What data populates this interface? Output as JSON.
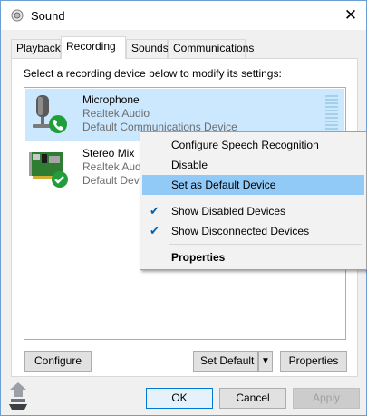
{
  "window": {
    "title": "Sound",
    "close_glyph": "✕"
  },
  "tabs": [
    {
      "label": "Playback"
    },
    {
      "label": "Recording",
      "active": true
    },
    {
      "label": "Sounds"
    },
    {
      "label": "Communications"
    }
  ],
  "panel": {
    "instruction": "Select a recording device below to modify its settings:"
  },
  "devices": [
    {
      "name": "Microphone",
      "driver": "Realtek Audio",
      "status": "Default Communications Device",
      "icon": "microphone-icon",
      "badge": "phone-badge-icon",
      "selected": true
    },
    {
      "name": "Stereo Mix",
      "driver": "Realtek Audio",
      "status": "Default Device",
      "icon": "sound-card-icon",
      "badge": "checkmark-badge-icon",
      "selected": false
    }
  ],
  "context_menu": {
    "items": [
      {
        "label": "Configure Speech Recognition"
      },
      {
        "label": "Disable"
      },
      {
        "label": "Set as Default Device",
        "highlighted": true
      },
      {
        "label": "Show Disabled Devices",
        "checked": true
      },
      {
        "label": "Show Disconnected Devices",
        "checked": true
      },
      {
        "label": "Properties",
        "bold": true
      }
    ],
    "check_glyph": "✔"
  },
  "buttons": {
    "configure": "Configure",
    "set_default": "Set Default",
    "set_default_arrow": "▼",
    "properties": "Properties",
    "ok": "OK",
    "cancel": "Cancel",
    "apply": "Apply"
  },
  "colors": {
    "selection": "#cce8ff",
    "menu_highlight": "#91c9f7",
    "ok_border": "#0078d7",
    "badge_green": "#1f9e3a"
  }
}
